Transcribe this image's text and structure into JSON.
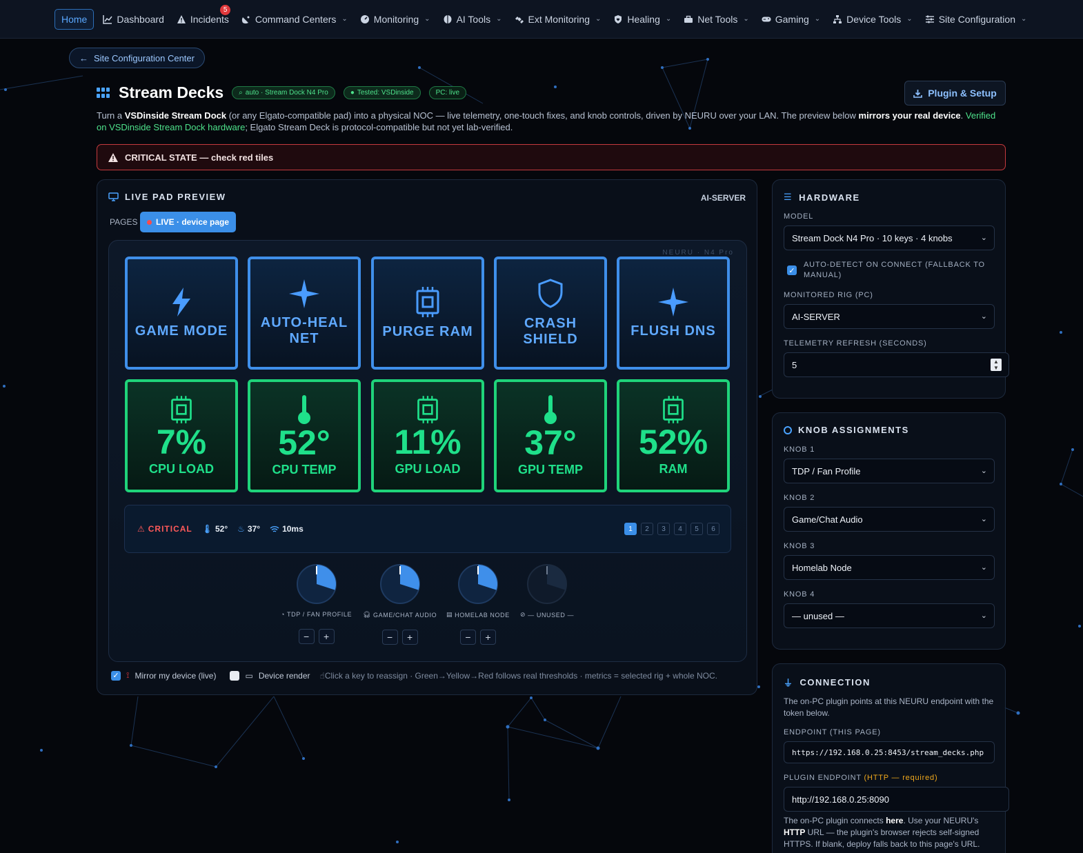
{
  "colors": {
    "accent": "#3b8fe8",
    "ok": "#1fd37a",
    "critical": "#e0383b",
    "warn": "#f0a81c"
  },
  "nav": {
    "home": "Home",
    "items": [
      {
        "label": "Dashboard",
        "icon": "chart-line-icon"
      },
      {
        "label": "Incidents",
        "icon": "warning-icon",
        "badge": "5"
      },
      {
        "label": "Command Centers",
        "icon": "satellite-dish-icon"
      },
      {
        "label": "Monitoring",
        "icon": "gauge-icon"
      },
      {
        "label": "AI Tools",
        "icon": "brain-icon"
      },
      {
        "label": "Ext Monitoring",
        "icon": "satellite-icon"
      },
      {
        "label": "Healing",
        "icon": "shield-heart-icon"
      },
      {
        "label": "Net Tools",
        "icon": "toolbox-icon"
      },
      {
        "label": "Gaming",
        "icon": "gamepad-icon"
      },
      {
        "label": "Device Tools",
        "icon": "sitemap-icon"
      },
      {
        "label": "Site Configuration",
        "icon": "sliders-icon"
      }
    ]
  },
  "back_button": "Site Configuration Center",
  "header": {
    "title": "Stream Decks",
    "badges": [
      "auto · Stream Dock N4 Pro",
      "Tested: VSDinside",
      "PC: live"
    ],
    "plugin_button": "Plugin & Setup"
  },
  "description": {
    "t1": "Turn a ",
    "b1": "VSDinside Stream Dock",
    "t2": " (or any Elgato-compatible pad) into a physical NOC — live telemetry, one-touch fixes, and knob controls, driven by NEURU over your LAN. The preview below ",
    "b2": "mirrors your real device",
    "t3": ". ",
    "g1": "Verified on VSDinside Stream Dock hardware",
    "t4": "; Elgato Stream Deck is protocol-compatible but not yet lab-verified."
  },
  "alert": "CRITICAL STATE — check red tiles",
  "preview": {
    "title": "LIVE PAD PREVIEW",
    "rig": "AI-SERVER",
    "pages_label": "PAGES",
    "live_page": "LIVE · device page",
    "device_brand": "NEURU · N4 Pro",
    "action_keys": [
      {
        "label_1": "GAME MODE",
        "label_2": "",
        "icon": "bolt-icon"
      },
      {
        "label_1": "AUTO-HEAL",
        "label_2": "NET",
        "icon": "sparkle-icon"
      },
      {
        "label_1": "PURGE RAM",
        "label_2": "",
        "icon": "chip-icon"
      },
      {
        "label_1": "CRASH",
        "label_2": "SHIELD",
        "icon": "shield-icon"
      },
      {
        "label_1": "FLUSH DNS",
        "label_2": "",
        "icon": "sparkle-icon"
      }
    ],
    "metric_keys": [
      {
        "value": "7%",
        "label": "CPU LOAD",
        "icon": "chip-icon"
      },
      {
        "value": "52°",
        "label": "CPU TEMP",
        "icon": "thermometer-icon"
      },
      {
        "value": "11%",
        "label": "GPU LOAD",
        "icon": "chip-icon"
      },
      {
        "value": "37°",
        "label": "GPU TEMP",
        "icon": "thermometer-icon"
      },
      {
        "value": "52%",
        "label": "RAM",
        "icon": "chip-icon"
      }
    ],
    "status": {
      "state": "CRITICAL",
      "cpu_temp": "52°",
      "gpu_temp": "37°",
      "latency": "10ms",
      "pages": [
        "1",
        "2",
        "3",
        "4",
        "5",
        "6"
      ],
      "active_page": "1"
    },
    "knobs": [
      {
        "label": "TDP / FAN PROFILE",
        "icon": "gauge-icon",
        "level": 0.3,
        "minus": "−",
        "plus": "+"
      },
      {
        "label": "GAME/CHAT AUDIO",
        "icon": "headphones-icon",
        "level": 0.3,
        "minus": "−",
        "plus": "+"
      },
      {
        "label": "HOMELAB NODE",
        "icon": "server-icon",
        "level": 0.3,
        "minus": "−",
        "plus": "+"
      },
      {
        "label": "— UNUSED —",
        "icon": "ban-icon",
        "level": 0.3
      }
    ],
    "footer": {
      "mirror": "Mirror my device (live)",
      "device_render": "Device render",
      "hint": "Click a key to reassign · Green→Yellow→Red follows real thresholds · metrics = selected rig + whole NOC."
    }
  },
  "hardware": {
    "title": "HARDWARE",
    "model_label": "MODEL",
    "model_value": "Stream Dock N4 Pro · 10 keys · 4 knobs",
    "autodetect_l1": "AUTO-DETECT ON CONNECT (FALLBACK TO",
    "autodetect_l2": "MANUAL)",
    "rig_label": "MONITORED RIG (PC)",
    "rig_value": "AI-SERVER",
    "refresh_label": "TELEMETRY REFRESH (SECONDS)",
    "refresh_value": "5"
  },
  "knob_assign": {
    "title": "KNOB ASSIGNMENTS",
    "knobs": [
      {
        "label": "KNOB 1",
        "value": "TDP / Fan Profile"
      },
      {
        "label": "KNOB 2",
        "value": "Game/Chat Audio"
      },
      {
        "label": "KNOB 3",
        "value": "Homelab Node"
      },
      {
        "label": "KNOB 4",
        "value": "— unused —"
      }
    ]
  },
  "connection": {
    "title": "CONNECTION",
    "intro": "The on-PC plugin points at this NEURU endpoint with the token below.",
    "endpoint_label": "ENDPOINT (THIS PAGE)",
    "endpoint_value": "https://192.168.0.25:8453/stream_decks.php",
    "plugin_label": "PLUGIN ENDPOINT",
    "plugin_req": "(HTTP — required)",
    "plugin_value": "http://192.168.0.25:8090",
    "note_1": "The on-PC plugin connects ",
    "note_b1": "here",
    "note_2": ". Use your NEURU's ",
    "note_b2": "HTTP",
    "note_3": " URL — the plugin's browser rejects self-signed HTTPS. If blank, deploy falls back to this page's URL."
  }
}
